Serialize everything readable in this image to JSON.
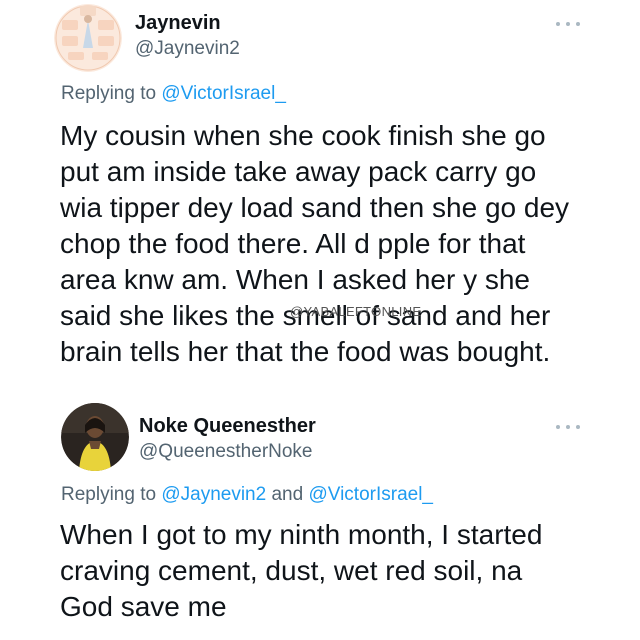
{
  "tweet1": {
    "name": "Jaynevin",
    "handle": "@Jaynevin2",
    "replying_prefix": "Replying to",
    "replying_mention": "@VictorIsrael_",
    "body_lines": [
      "My cousin when she cook finish she go",
      "put am inside take away pack carry go",
      "wia tipper dey load sand then she go dey",
      "chop the food there. All d pple for that",
      "area knw am. When I asked her y she",
      "said she likes the smell of sand and her",
      "brain tells her that the food was bought."
    ],
    "avatar_icon": "decorative-avatar-icon",
    "more_icon": "more-dots-icon"
  },
  "watermark": "@YABALEFTONLINE",
  "tweet2": {
    "name": "Noke Queenesther",
    "handle": "@QueenestherNoke",
    "replying_prefix": "Replying to",
    "replying_mention_1": "@Jaynevin2",
    "replying_and": "and",
    "replying_mention_2": "@VictorIsrael_",
    "body_lines": [
      "When I got to my ninth month, I started",
      "craving cement, dust, wet red soil, na",
      "God save me"
    ],
    "avatar_icon": "user-photo-avatar-icon",
    "more_icon": "more-dots-icon"
  },
  "colors": {
    "text": "#0f1419",
    "secondary": "#536471",
    "mention": "#1d9bf0"
  }
}
